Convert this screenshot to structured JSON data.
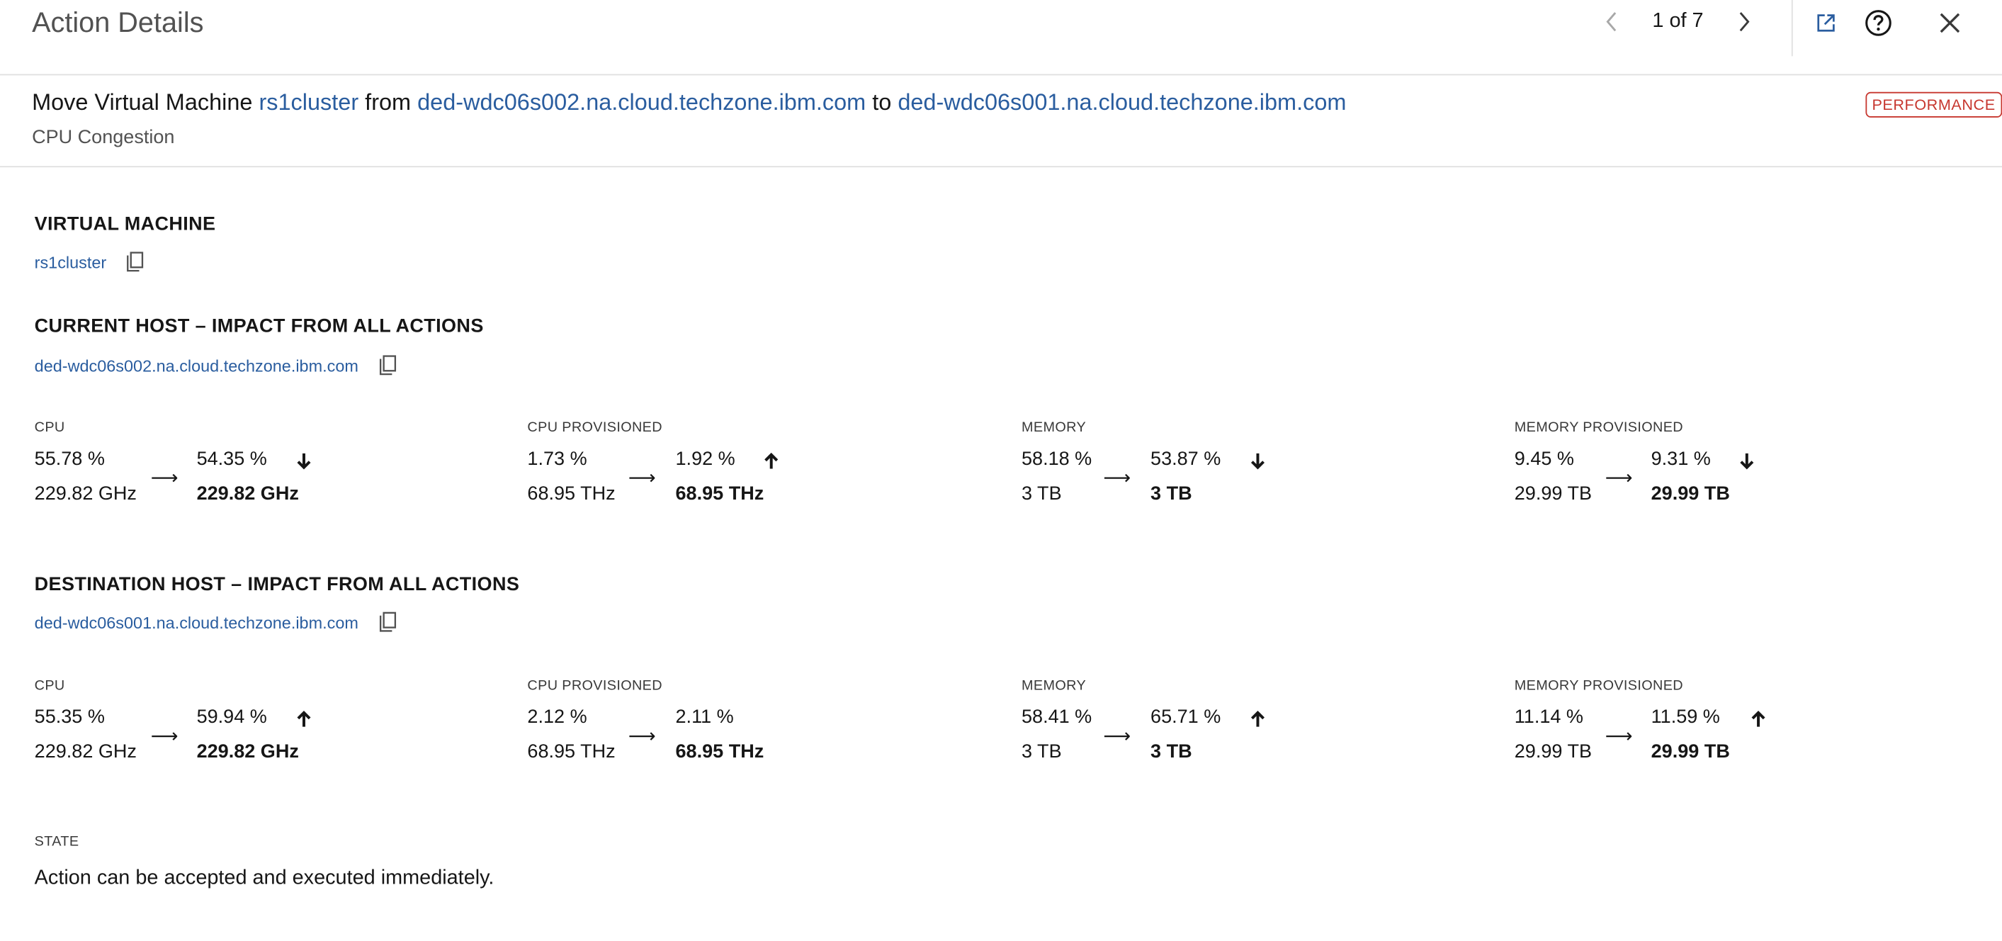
{
  "header": {
    "title": "Action Details",
    "pager": "1 of 7",
    "icons": [
      "chevron-left-icon",
      "chevron-right-icon",
      "launch-icon",
      "help-icon",
      "close-icon"
    ],
    "accent_color": "#2a5d9f"
  },
  "summary": {
    "action_prefix": "Move Virtual Machine",
    "vm_name": "rs1cluster",
    "from_word": "from",
    "source_host": "ded-wdc06s002.na.cloud.techzone.ibm.com",
    "to_word": "to",
    "destination_host": "ded-wdc06s001.na.cloud.techzone.ibm.com",
    "reason": "CPU Congestion",
    "badge": "PERFORMANCE",
    "badge_color": "#c7372f"
  },
  "virtual_machine": {
    "title": "VIRTUAL MACHINE",
    "name": "rs1cluster"
  },
  "current_host": {
    "title": "CURRENT HOST – IMPACT FROM ALL ACTIONS",
    "name": "ded-wdc06s002.na.cloud.techzone.ibm.com",
    "metrics": [
      {
        "label": "CPU",
        "before_pct": "55.78 %",
        "before_abs": "229.82 GHz",
        "after_pct": "54.35 %",
        "after_abs": "229.82 GHz",
        "trend": "down"
      },
      {
        "label": "CPU PROVISIONED",
        "before_pct": "1.73 %",
        "before_abs": "68.95 THz",
        "after_pct": "1.92 %",
        "after_abs": "68.95 THz",
        "trend": "up"
      },
      {
        "label": "MEMORY",
        "before_pct": "58.18 %",
        "before_abs": "3 TB",
        "after_pct": "53.87 %",
        "after_abs": "3 TB",
        "trend": "down"
      },
      {
        "label": "MEMORY PROVISIONED",
        "before_pct": "9.45 %",
        "before_abs": "29.99 TB",
        "after_pct": "9.31 %",
        "after_abs": "29.99 TB",
        "trend": "down"
      }
    ]
  },
  "destination_host": {
    "title": "DESTINATION HOST – IMPACT FROM ALL ACTIONS",
    "name": "ded-wdc06s001.na.cloud.techzone.ibm.com",
    "metrics": [
      {
        "label": "CPU",
        "before_pct": "55.35 %",
        "before_abs": "229.82 GHz",
        "after_pct": "59.94 %",
        "after_abs": "229.82 GHz",
        "trend": "up"
      },
      {
        "label": "CPU PROVISIONED",
        "before_pct": "2.12 %",
        "before_abs": "68.95 THz",
        "after_pct": "2.11 %",
        "after_abs": "68.95 THz",
        "trend": "none"
      },
      {
        "label": "MEMORY",
        "before_pct": "58.41 %",
        "before_abs": "3 TB",
        "after_pct": "65.71 %",
        "after_abs": "3 TB",
        "trend": "up"
      },
      {
        "label": "MEMORY PROVISIONED",
        "before_pct": "11.14 %",
        "before_abs": "29.99 TB",
        "after_pct": "11.59 %",
        "after_abs": "29.99 TB",
        "trend": "up"
      }
    ]
  },
  "state": {
    "label": "STATE",
    "text": "Action can be accepted and executed immediately."
  }
}
